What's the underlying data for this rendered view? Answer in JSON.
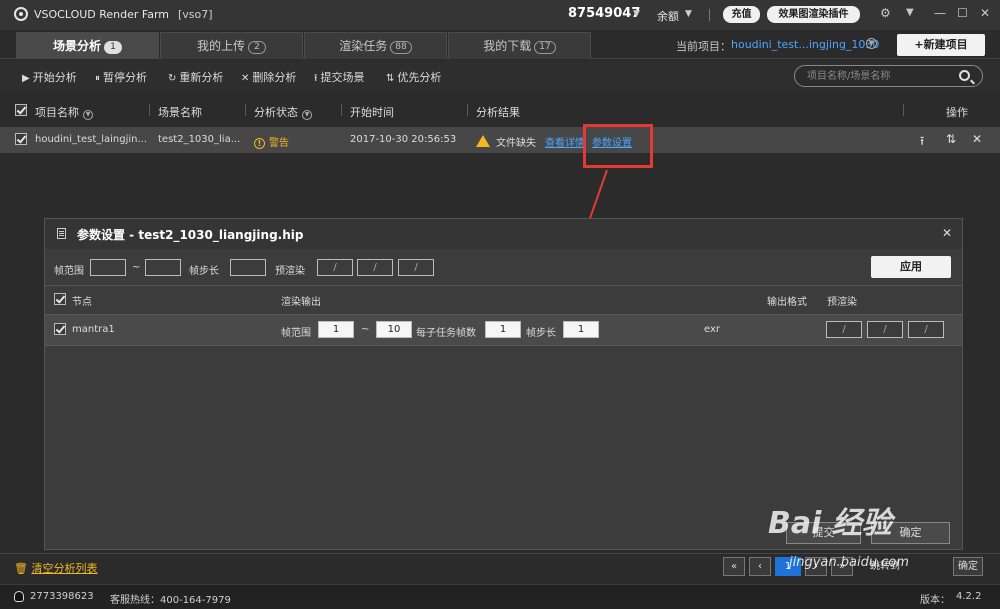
{
  "app": {
    "title": "VSOCLOUD Render Farm",
    "user": "[vso7]"
  },
  "account": {
    "id": "87549047",
    "balance_label": "余额",
    "recharge": "充值",
    "plugin": "效果图渲染插件"
  },
  "tabs": [
    {
      "label": "场景分析",
      "count": "1"
    },
    {
      "label": "我的上传",
      "count": "2"
    },
    {
      "label": "渲染任务",
      "count": "88"
    },
    {
      "label": "我的下载",
      "count": "17"
    }
  ],
  "project": {
    "label": "当前项目：",
    "name": "houdini_test...ingjing_1030",
    "new_button": "+新建项目"
  },
  "toolbar": {
    "items": [
      {
        "icon": "▶",
        "label": "开始分析"
      },
      {
        "icon": "⏸",
        "label": "暂停分析"
      },
      {
        "icon": "↻",
        "label": "重新分析"
      },
      {
        "icon": "✕",
        "label": "删除分析"
      },
      {
        "icon": "⭱",
        "label": "提交场景"
      },
      {
        "icon": "⇅",
        "label": "优先分析"
      }
    ],
    "search_placeholder": "项目名称/场景名称"
  },
  "table": {
    "headers": [
      "项目名称",
      "场景名称",
      "分析状态",
      "开始时间",
      "分析结果",
      "操作"
    ],
    "row": {
      "project": "houdini_test_laingjin...",
      "scene": "test2_1030_lia...",
      "status": "警告",
      "start_time": "2017-10-30 20:56:53",
      "result_text": "文件缺失",
      "details_link": "查看详情",
      "settings_link": "参数设置"
    }
  },
  "dialog": {
    "title": "参数设置   -   test2_1030_liangjing.hip",
    "frame_range_label": "帧范围",
    "tilde": "~",
    "step_label": "帧步长",
    "prerender_label": "预渲染",
    "slash": "/",
    "apply": "应用",
    "headers": {
      "node": "节点",
      "render_output": "渲染输出",
      "output_format": "输出格式",
      "prerender": "预渲染"
    },
    "row": {
      "node": "mantra1",
      "frame_range_label": "帧范围",
      "start": "1",
      "tilde": "~",
      "end": "10",
      "frames_per_task_label": "每子任务帧数",
      "frames_per_task": "1",
      "step_label": "帧步长",
      "step": "1",
      "format": "exr"
    },
    "submit": "提交",
    "confirm": "确定"
  },
  "footer": {
    "clear": "清空分析列表",
    "pager": {
      "first": "«",
      "prev": "‹",
      "page": "1",
      "next": "›",
      "last": "»",
      "goto": "跳转到",
      "confirm": "确定"
    },
    "qq": "2773398623",
    "hotline": "客服热线：400-164-7979",
    "version_label": "版本：",
    "version": "4.2.2"
  },
  "watermark": {
    "text": "Bai 经验",
    "sub": "jingyan.baidu.com"
  },
  "colors": {
    "accent": "#1e73d8",
    "warning": "#f3b81d",
    "link": "#4ba6ff",
    "annotation": "#e53935"
  }
}
